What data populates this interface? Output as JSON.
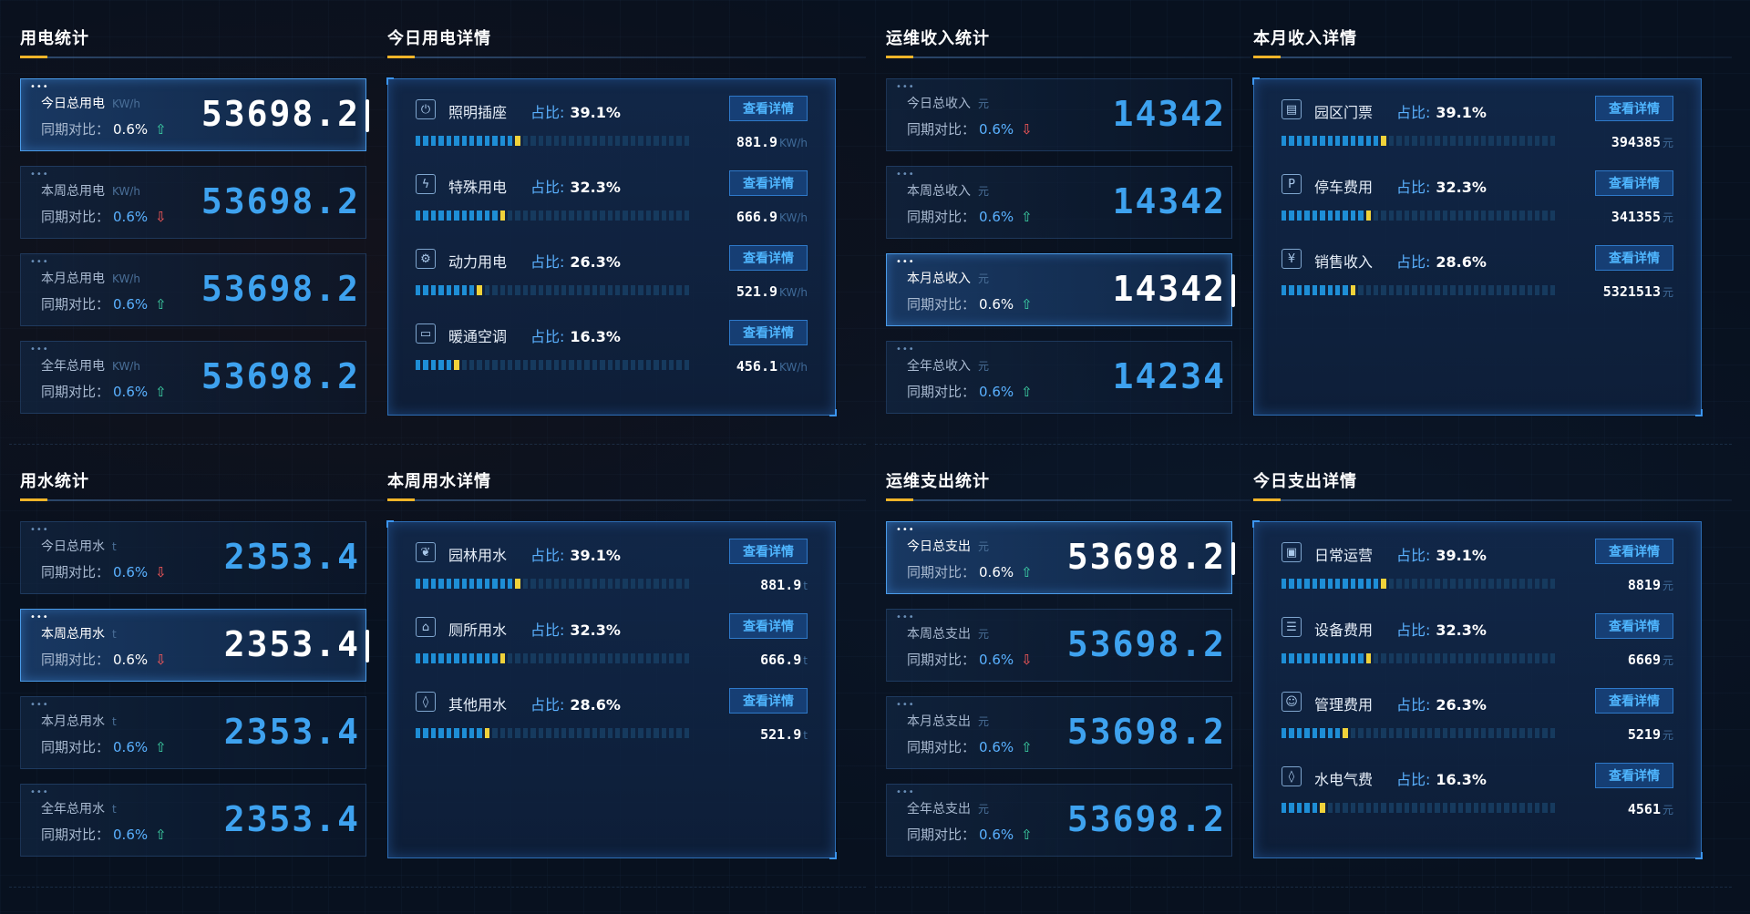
{
  "quadrants": [
    {
      "stat_title": "用电统计",
      "detail_title": "今日用电详情",
      "stats": [
        {
          "label": "今日总用电",
          "unit": "KW/h",
          "cmp_label": "同期对比：",
          "pct": "0.6%",
          "arrow": "⇧",
          "dir": "up",
          "value": "53698.2",
          "active": true
        },
        {
          "label": "本周总用电",
          "unit": "KW/h",
          "cmp_label": "同期对比：",
          "pct": "0.6%",
          "arrow": "⇩",
          "dir": "down",
          "value": "53698.2",
          "active": false
        },
        {
          "label": "本月总用电",
          "unit": "KW/h",
          "cmp_label": "同期对比：",
          "pct": "0.6%",
          "arrow": "⇧",
          "dir": "up",
          "value": "53698.2",
          "active": false
        },
        {
          "label": "全年总用电",
          "unit": "KW/h",
          "cmp_label": "同期对比：",
          "pct": "0.6%",
          "arrow": "⇧",
          "dir": "up",
          "value": "53698.2",
          "active": false
        }
      ],
      "rows": [
        {
          "icon": "plug-icon",
          "glyph": "⏻",
          "name": "照明插座",
          "share_label": "占比:",
          "share": "39.1%",
          "button": "查看详情",
          "value": "881.9",
          "unit": "KW/h",
          "fill": 0.391
        },
        {
          "icon": "lightning-icon",
          "glyph": "ϟ",
          "name": "特殊用电",
          "share_label": "占比:",
          "share": "32.3%",
          "button": "查看详情",
          "value": "666.9",
          "unit": "KW/h",
          "fill": 0.323
        },
        {
          "icon": "gear-icon",
          "glyph": "⚙",
          "name": "动力用电",
          "share_label": "占比:",
          "share": "26.3%",
          "button": "查看详情",
          "value": "521.9",
          "unit": "KW/h",
          "fill": 0.263
        },
        {
          "icon": "air-conditioner-icon",
          "glyph": "▭",
          "name": "暖通空调",
          "share_label": "占比:",
          "share": "16.3%",
          "button": "查看详情",
          "value": "456.1",
          "unit": "KW/h",
          "fill": 0.163
        }
      ]
    },
    {
      "stat_title": "运维收入统计",
      "detail_title": "本月收入详情",
      "stats": [
        {
          "label": "今日总收入",
          "unit": "元",
          "cmp_label": "同期对比：",
          "pct": "0.6%",
          "arrow": "⇩",
          "dir": "down",
          "value": "14342",
          "active": false
        },
        {
          "label": "本周总收入",
          "unit": "元",
          "cmp_label": "同期对比：",
          "pct": "0.6%",
          "arrow": "⇧",
          "dir": "up",
          "value": "14342",
          "active": false
        },
        {
          "label": "本月总收入",
          "unit": "元",
          "cmp_label": "同期对比：",
          "pct": "0.6%",
          "arrow": "⇧",
          "dir": "up",
          "value": "14342",
          "active": true
        },
        {
          "label": "全年总收入",
          "unit": "元",
          "cmp_label": "同期对比：",
          "pct": "0.6%",
          "arrow": "⇧",
          "dir": "up",
          "value": "14234",
          "active": false
        }
      ],
      "rows": [
        {
          "icon": "ticket-icon",
          "glyph": "▤",
          "name": "园区门票",
          "share_label": "占比:",
          "share": "39.1%",
          "button": "查看详情",
          "value": "394385",
          "unit": "元",
          "fill": 0.391
        },
        {
          "icon": "parking-icon",
          "glyph": "P",
          "name": "停车费用",
          "share_label": "占比:",
          "share": "32.3%",
          "button": "查看详情",
          "value": "341355",
          "unit": "元",
          "fill": 0.323
        },
        {
          "icon": "yen-icon",
          "glyph": "¥",
          "name": "销售收入",
          "share_label": "占比:",
          "share": "28.6%",
          "button": "查看详情",
          "value": "5321513",
          "unit": "元",
          "fill": 0.286
        }
      ]
    },
    {
      "stat_title": "用水统计",
      "detail_title": "本周用水详情",
      "stats": [
        {
          "label": "今日总用水",
          "unit": "t",
          "cmp_label": "同期对比：",
          "pct": "0.6%",
          "arrow": "⇩",
          "dir": "down",
          "value": "2353.4",
          "active": false
        },
        {
          "label": "本周总用水",
          "unit": "t",
          "cmp_label": "同期对比：",
          "pct": "0.6%",
          "arrow": "⇩",
          "dir": "down",
          "value": "2353.4",
          "active": true
        },
        {
          "label": "本月总用水",
          "unit": "t",
          "cmp_label": "同期对比：",
          "pct": "0.6%",
          "arrow": "⇧",
          "dir": "up",
          "value": "2353.4",
          "active": false
        },
        {
          "label": "全年总用水",
          "unit": "t",
          "cmp_label": "同期对比：",
          "pct": "0.6%",
          "arrow": "⇧",
          "dir": "up",
          "value": "2353.4",
          "active": false
        }
      ],
      "rows": [
        {
          "icon": "leaf-icon",
          "glyph": "❦",
          "name": "园林用水",
          "share_label": "占比:",
          "share": "39.1%",
          "button": "查看详情",
          "value": "881.9",
          "unit": "t",
          "fill": 0.391
        },
        {
          "icon": "toilet-icon",
          "glyph": "⌂",
          "name": "厕所用水",
          "share_label": "占比:",
          "share": "32.3%",
          "button": "查看详情",
          "value": "666.9",
          "unit": "t",
          "fill": 0.323
        },
        {
          "icon": "water-drop-icon",
          "glyph": "◊",
          "name": "其他用水",
          "share_label": "占比:",
          "share": "28.6%",
          "button": "查看详情",
          "value": "521.9",
          "unit": "t",
          "fill": 0.286
        }
      ]
    },
    {
      "stat_title": "运维支出统计",
      "detail_title": "今日支出详情",
      "stats": [
        {
          "label": "今日总支出",
          "unit": "元",
          "cmp_label": "同期对比：",
          "pct": "0.6%",
          "arrow": "⇧",
          "dir": "up",
          "value": "53698.2",
          "active": true
        },
        {
          "label": "本周总支出",
          "unit": "元",
          "cmp_label": "同期对比：",
          "pct": "0.6%",
          "arrow": "⇩",
          "dir": "down",
          "value": "53698.2",
          "active": false
        },
        {
          "label": "本月总支出",
          "unit": "元",
          "cmp_label": "同期对比：",
          "pct": "0.6%",
          "arrow": "⇧",
          "dir": "up",
          "value": "53698.2",
          "active": false
        },
        {
          "label": "全年总支出",
          "unit": "元",
          "cmp_label": "同期对比：",
          "pct": "0.6%",
          "arrow": "⇧",
          "dir": "up",
          "value": "53698.2",
          "active": false
        }
      ],
      "rows": [
        {
          "icon": "monitor-chart-icon",
          "glyph": "▣",
          "name": "日常运营",
          "share_label": "占比:",
          "share": "39.1%",
          "button": "查看详情",
          "value": "8819",
          "unit": "元",
          "fill": 0.391
        },
        {
          "icon": "list-icon",
          "glyph": "☰",
          "name": "设备费用",
          "share_label": "占比:",
          "share": "32.3%",
          "button": "查看详情",
          "value": "6669",
          "unit": "元",
          "fill": 0.323
        },
        {
          "icon": "user-icon",
          "glyph": "☺",
          "name": "管理费用",
          "share_label": "占比:",
          "share": "26.3%",
          "button": "查看详情",
          "value": "5219",
          "unit": "元",
          "fill": 0.263
        },
        {
          "icon": "utility-drop-icon",
          "glyph": "◊",
          "name": "水电气费",
          "share_label": "占比:",
          "share": "16.3%",
          "button": "查看详情",
          "value": "4561",
          "unit": "元",
          "fill": 0.163
        }
      ]
    }
  ],
  "colors": {
    "accent": "#3ea2ef",
    "up": "#3ed6a8",
    "down": "#ff5a5a",
    "bar_tip": "#f0d23a",
    "title_underline": "#f0b429"
  }
}
